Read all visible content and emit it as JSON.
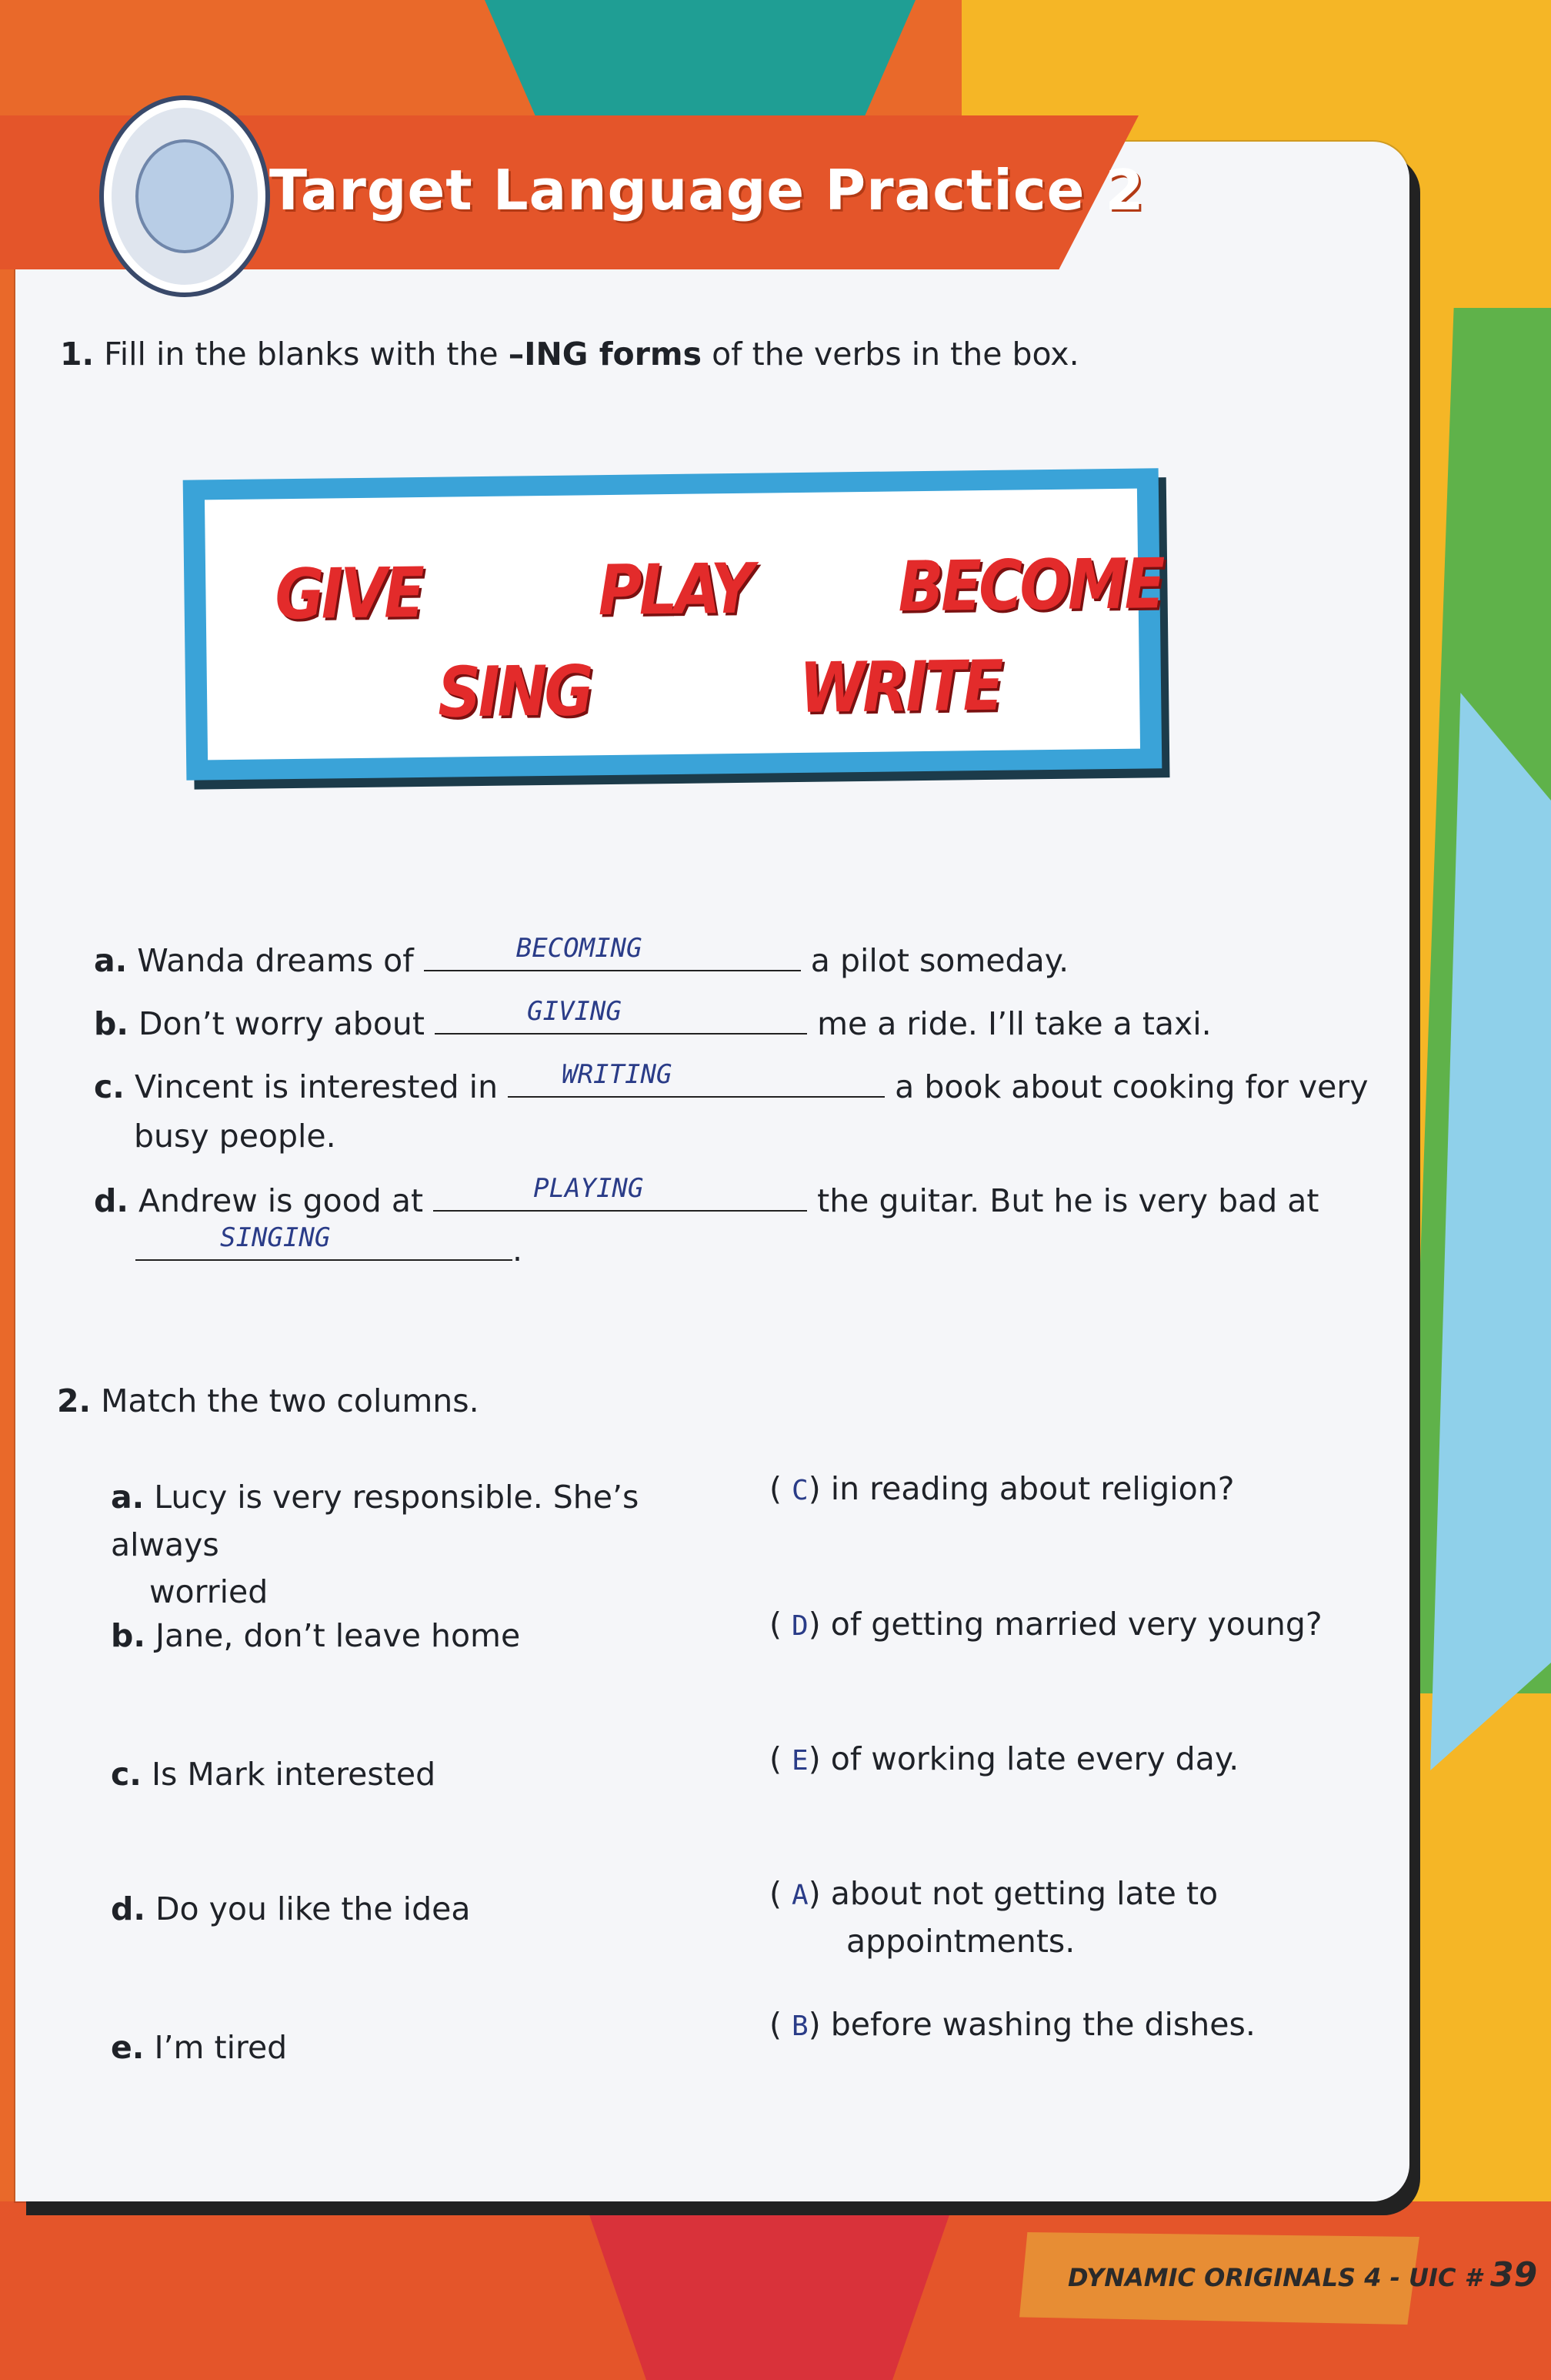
{
  "header": {
    "title": "Target Language Practice 2"
  },
  "exercise1": {
    "number": "1.",
    "instruction_pre": "Fill in the blanks with the ",
    "instruction_bold": "–ING forms",
    "instruction_post": " of the verbs in the box.",
    "verbs": [
      "GIVE",
      "PLAY",
      "BECOME",
      "SING",
      "WRITE"
    ],
    "items": [
      {
        "letter": "a.",
        "before": "Wanda dreams of",
        "answer": "BECOMING",
        "after": "a pilot someday."
      },
      {
        "letter": "b.",
        "before": "Don’t worry about",
        "answer": "GIVING",
        "after": "me a ride. I’ll take a taxi."
      },
      {
        "letter": "c.",
        "before": "Vincent is interested in",
        "answer": "WRITING",
        "after": "a book about cooking for very",
        "after2": "busy people."
      },
      {
        "letter": "d.",
        "before": "Andrew is good at",
        "answer": "PLAYING",
        "after": "the guitar. But he is very bad at",
        "answer2": "SINGING",
        "end": "."
      }
    ]
  },
  "exercise2": {
    "number": "2.",
    "instruction": "Match the two columns.",
    "left": [
      {
        "letter": "a.",
        "text": "Lucy is very responsible. She’s always",
        "text2": "worried"
      },
      {
        "letter": "b.",
        "text": "Jane, don’t leave home"
      },
      {
        "letter": "c.",
        "text": "Is Mark interested"
      },
      {
        "letter": "d.",
        "text": "Do you like the idea"
      },
      {
        "letter": "e.",
        "text": "I’m tired"
      }
    ],
    "right": [
      {
        "answer": "C",
        "text": "in reading about religion?"
      },
      {
        "answer": "D",
        "text": "of getting married very young?"
      },
      {
        "answer": "E",
        "text": "of working late every day."
      },
      {
        "answer": "A",
        "text": "about not getting late to",
        "text2": "appointments."
      },
      {
        "answer": "B",
        "text": "before washing the dishes."
      }
    ]
  },
  "footer": {
    "label": "DYNAMIC ORIGINALS 4 - UIC #",
    "page": "39"
  }
}
